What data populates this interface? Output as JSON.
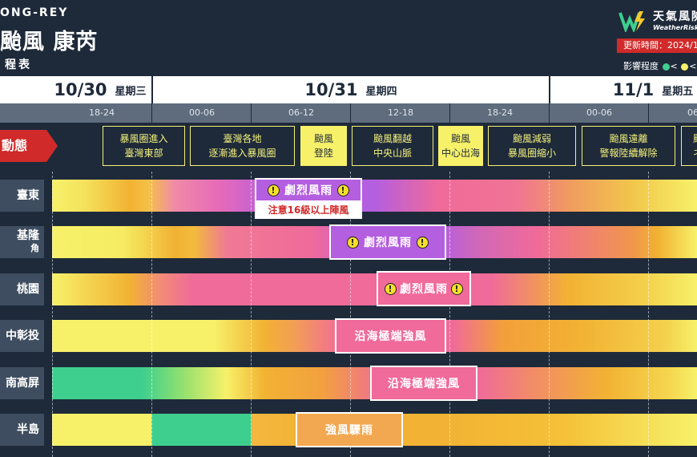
{
  "header": {
    "english_name": "ONG-REY",
    "title": "颱風 康芮",
    "subtitle": "程表",
    "logo_cn": "天氣風險",
    "logo_en": "WeatherRisk",
    "update_label": "更新時間：2024/1",
    "impact_label": "影響程度",
    "impact_symbols": "<",
    "impact_symbols2": "<"
  },
  "dates": [
    {
      "date": "10/30",
      "weekday": "星期三"
    },
    {
      "date": "10/31",
      "weekday": "星期四"
    },
    {
      "date": "11/1",
      "weekday": "星期五"
    }
  ],
  "time_slots": [
    "18-24",
    "00-06",
    "06-12",
    "12-18",
    "18-24",
    "00-06",
    "06"
  ],
  "dynamics_label": "動態",
  "stages": [
    {
      "line1": "暴風圈進入",
      "line2": "臺灣東部",
      "highlight": false
    },
    {
      "line1": "臺灣各地",
      "line2": "逐漸進入暴風圈",
      "highlight": false
    },
    {
      "line1": "颱風",
      "line2": "登陸",
      "highlight": true
    },
    {
      "line1": "颱風翻越",
      "line2": "中央山脈",
      "highlight": false
    },
    {
      "line1": "颱風",
      "line2": "中心出海",
      "highlight": true
    },
    {
      "line1": "颱風減弱",
      "line2": "暴風圈縮小",
      "highlight": false
    },
    {
      "line1": "颱風遠離",
      "line2": "警報陸續解除",
      "highlight": false
    },
    {
      "line1": "颱",
      "line2": "ネ",
      "highlight": false
    }
  ],
  "regions": [
    {
      "label": "臺東",
      "sub": "",
      "tag": "劇烈風雨",
      "warn": true
    },
    {
      "label": "基隆",
      "sub": "角",
      "tag": "劇烈風雨",
      "warn": true
    },
    {
      "label": "桃園",
      "sub": "",
      "tag": "劇烈風雨",
      "warn": true
    },
    {
      "label": "中彰投",
      "sub": "",
      "tag": "沿海極端強風",
      "warn": false
    },
    {
      "label": "南高屏",
      "sub": "",
      "tag": "沿海極端強風",
      "warn": false
    },
    {
      "label": "半島",
      "sub": "",
      "tag": "強風驟雨",
      "warn": false
    }
  ],
  "note": "注意16級以上陣風",
  "colors": {
    "background": "#1e2a3a",
    "level_green": "#3ecf8e",
    "level_yellow": "#f7f16a",
    "level_orange": "#f2b233",
    "level_pink": "#f06a9a",
    "level_purple": "#b45ee0",
    "alert_red": "#d02a2a"
  }
}
